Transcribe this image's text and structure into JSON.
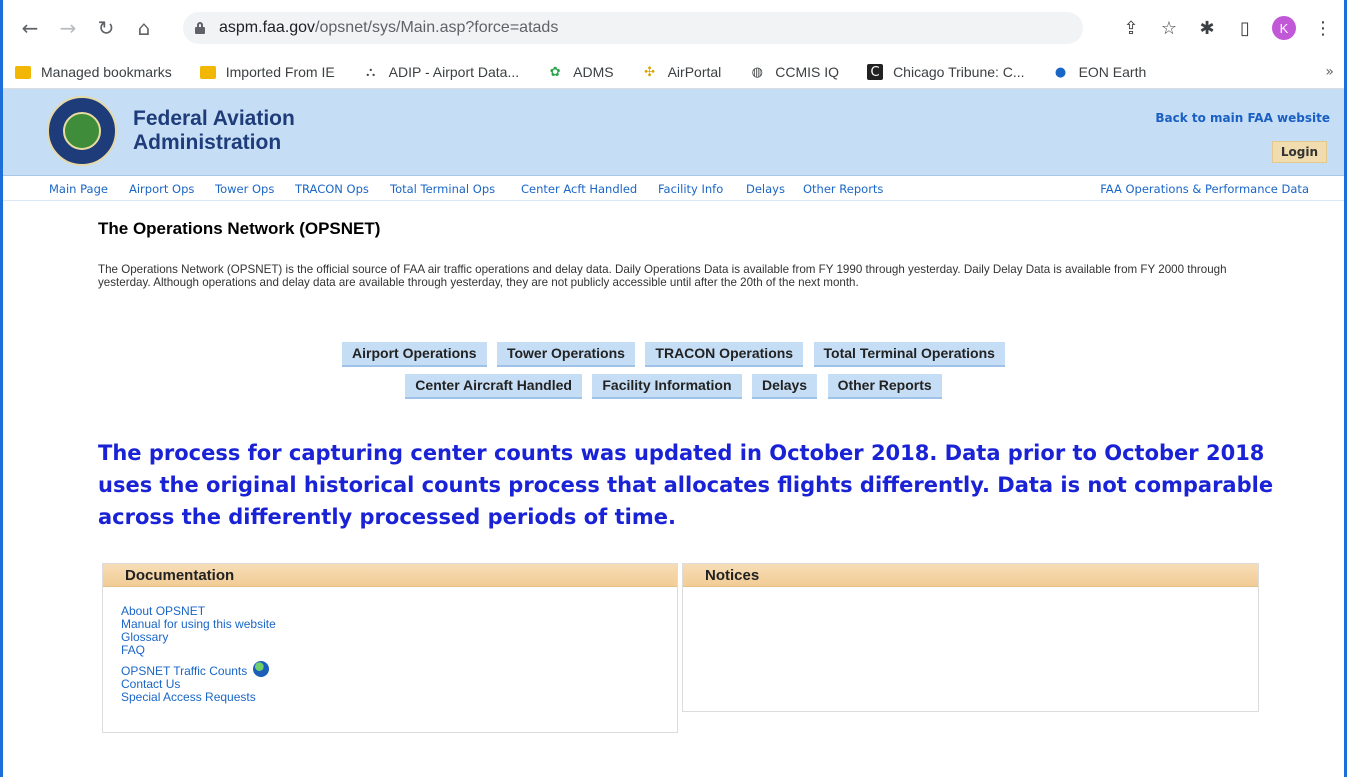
{
  "browser": {
    "url_domain": "aspm.faa.gov",
    "url_path": "/opsnet/sys/Main.asp?force=atads",
    "profile_initial": "K",
    "bookmarks": [
      "Managed bookmarks",
      "Imported From IE",
      "ADIP - Airport Data...",
      "ADMS",
      "AirPortal",
      "CCMIS IQ",
      "Chicago Tribune: C...",
      "EON Earth"
    ],
    "bookmarks_more": "»"
  },
  "header": {
    "agency_line1": "Federal Aviation",
    "agency_line2": "Administration",
    "back_link": "Back to main FAA website",
    "login": "Login"
  },
  "nav": {
    "items": [
      "Main Page",
      "Airport Ops",
      "Tower Ops",
      "TRACON Ops",
      "Total Terminal Ops",
      "Center Acft Handled",
      "Facility Info",
      "Delays",
      "Other Reports"
    ],
    "right_link": "FAA Operations & Performance Data"
  },
  "main": {
    "title": "The Operations Network (OPSNET)",
    "intro": "The Operations Network (OPSNET) is the official source of FAA air traffic operations and delay data. Daily Operations Data is available from FY 1990 through yesterday. Daily Delay Data is available from FY 2000 through yesterday. Although operations and delay data are available through yesterday, they are not publicly accessible until after the 20th of the next month.",
    "buttons_row1": [
      "Airport Operations",
      "Tower Operations",
      "TRACON Operations",
      "Total Terminal Operations"
    ],
    "buttons_row2": [
      "Center Aircraft Handled",
      "Facility Information",
      "Delays",
      "Other Reports"
    ],
    "notice": "The process for capturing center counts was updated in October 2018. Data prior to October 2018 uses the original historical counts process that allocates flights differently. Data is not comparable across the differently processed periods of time."
  },
  "documentation": {
    "title": "Documentation",
    "links": [
      "About OPSNET",
      "Manual for using this website",
      "Glossary",
      "FAQ",
      "OPSNET Traffic Counts",
      "Contact Us",
      "Special Access Requests"
    ]
  },
  "notices": {
    "title": "Notices"
  }
}
